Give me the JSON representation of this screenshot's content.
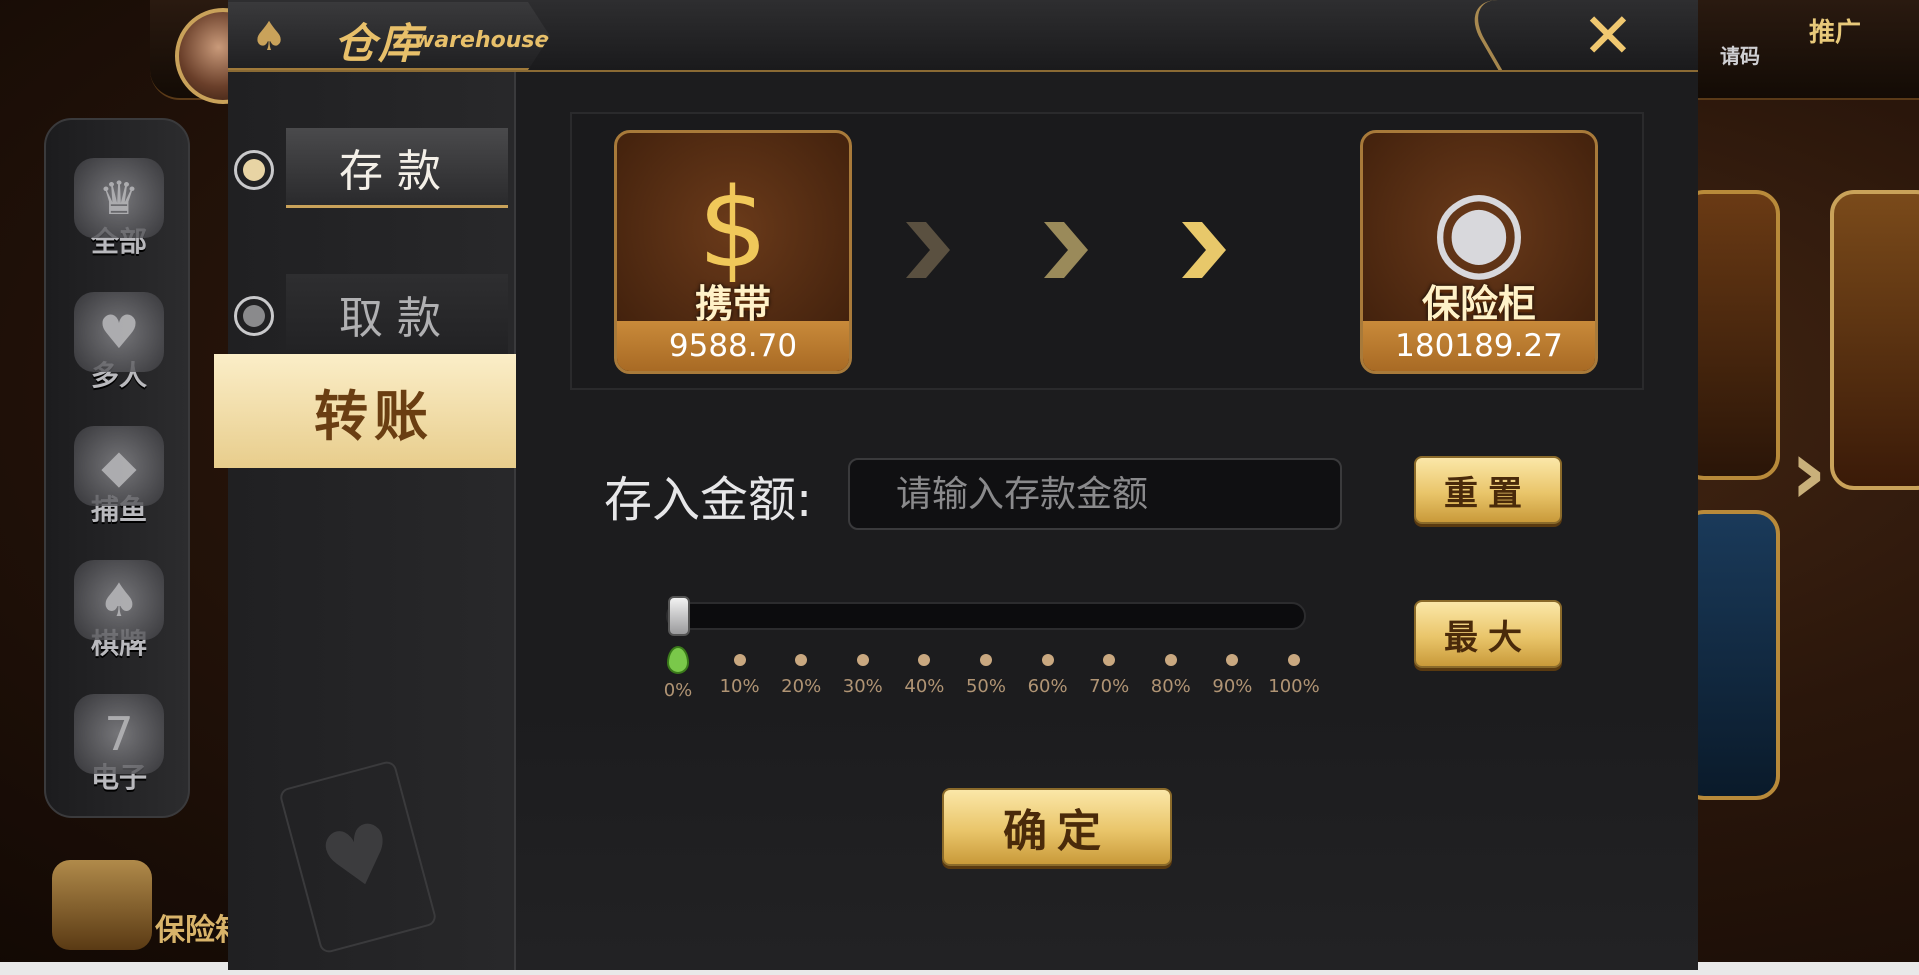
{
  "header": {
    "title_cn": "仓库",
    "title_en": "warehouse",
    "close_symbol": "✕"
  },
  "background": {
    "sidebar": [
      {
        "label": "全部",
        "icon": "crown-icon"
      },
      {
        "label": "多人",
        "icon": "heart-icon"
      },
      {
        "label": "捕鱼",
        "icon": "fish-icon"
      },
      {
        "label": "棋牌",
        "icon": "cards-icon"
      },
      {
        "label": "电子",
        "icon": "slot-icon"
      }
    ],
    "invite_label": "请码",
    "promo_label": "推广",
    "safe_label": "保险箱"
  },
  "tabs": {
    "deposit": "存款",
    "withdraw": "取款",
    "transfer": "转账"
  },
  "wallets": {
    "carry": {
      "caption": "携带",
      "amount": "9588.70"
    },
    "safe": {
      "caption": "保险柜",
      "amount": "180189.27"
    }
  },
  "form": {
    "amount_label": "存入金额:",
    "amount_placeholder": "请输入存款金额",
    "amount_value": "",
    "reset_label": "重置",
    "max_label": "最大",
    "confirm_label": "确定"
  },
  "slider": {
    "value_percent": 0,
    "ticks": [
      "0%",
      "10%",
      "20%",
      "30%",
      "40%",
      "50%",
      "60%",
      "70%",
      "80%",
      "90%",
      "100%"
    ]
  },
  "colors": {
    "gold": "#e9c56a",
    "modal_bg": "#19191b",
    "accent_brown": "#a86a24"
  }
}
